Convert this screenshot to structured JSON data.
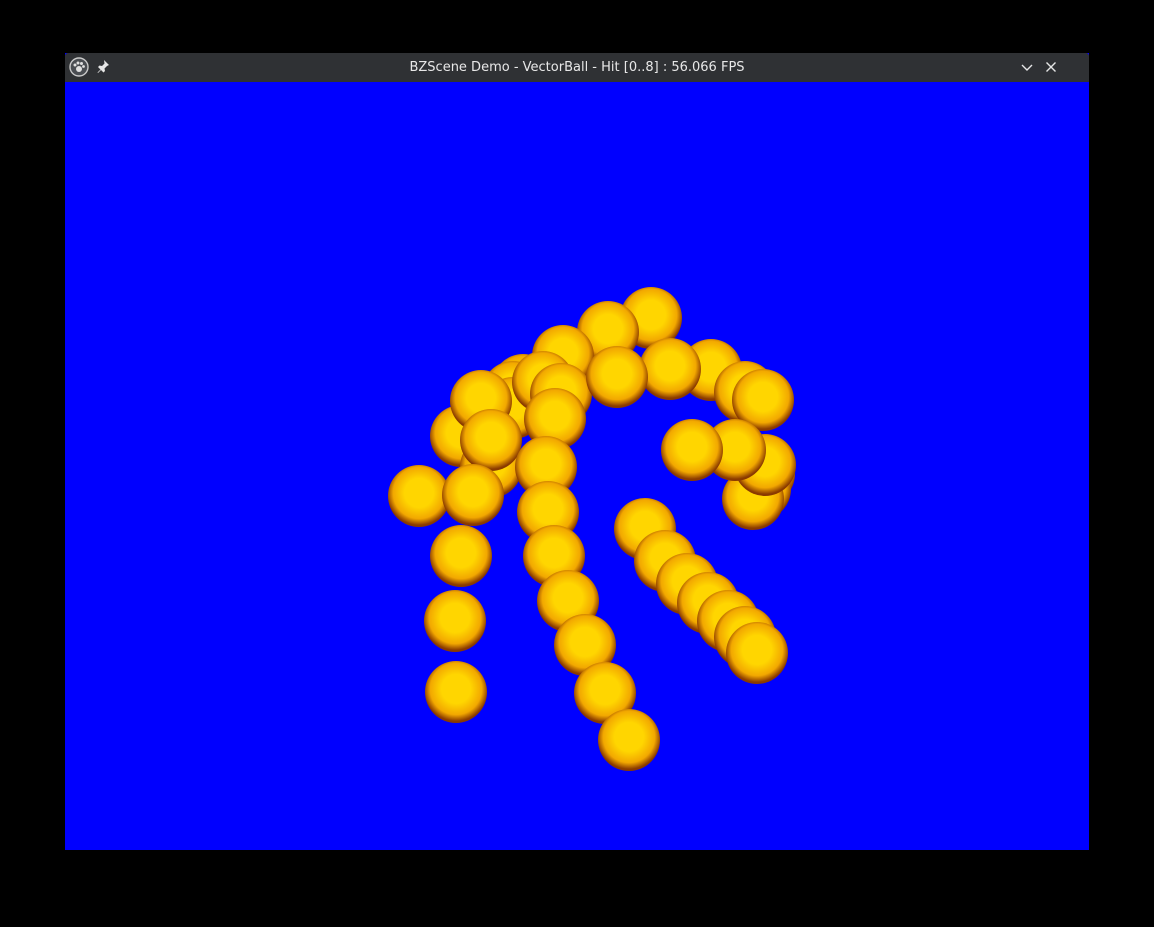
{
  "window": {
    "title": "BZScene Demo - VectorBall - Hit [0..8] : 56.066 FPS",
    "icons": {
      "app": "paw-icon",
      "pin": "pin-icon",
      "minimize": "chevron-down-icon",
      "close": "close-icon"
    }
  },
  "scene": {
    "name": "VectorBall",
    "background_color": "#0000ff",
    "ball_colors": {
      "highlight": "#ffd600",
      "mid": "#f2a800",
      "edge": "#8a3a00"
    }
  }
}
